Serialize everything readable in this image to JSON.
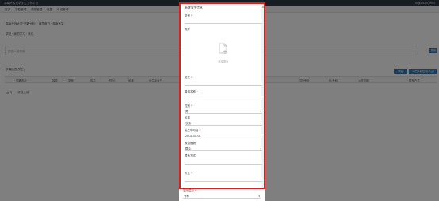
{
  "app": {
    "title": "湖南开放大学学生工作平台",
    "user": "sxguo4@Qmb4"
  },
  "nav": [
    "首页",
    "学籍管理",
    "成绩管理",
    "设置",
    "考试管理"
  ],
  "breadcrumb": "湖南开放大学\"学籍分析\" · 满意度日 · 湖南大学",
  "filters": "学院 · 我的学习 · 状态",
  "search": {
    "placeholder": "搜索人名搜索",
    "button": "搜索"
  },
  "list": {
    "title": "学籍信息(学生)",
    "buttons": {
      "add": "添加",
      "import": "导出学籍信息(学生)"
    },
    "columns": [
      "学籍状态",
      "操作",
      "学号",
      "姓名",
      "性别",
      "民族",
      "出生年月日",
      "联系方式",
      "学历专业",
      "年/专科",
      "入学日期",
      "联系方式"
    ]
  },
  "pager": {
    "prev": "上页",
    "next": "末端上页"
  },
  "modal": {
    "title": "新增学生信息",
    "fields": {
      "student_id": {
        "label": "学号",
        "required": true,
        "value": ""
      },
      "photo": {
        "label": "照片",
        "upload_text": "选择图片"
      },
      "name": {
        "label": "姓名",
        "required": true,
        "value": ""
      },
      "former_name": {
        "label": "曾用名称",
        "required": true,
        "value": ""
      },
      "gender": {
        "label": "性别",
        "required": true,
        "value": "男"
      },
      "ethnicity": {
        "label": "民族",
        "required": false,
        "value": "汉族"
      },
      "birth_date": {
        "label": "出生年月日",
        "required": true,
        "value": "2014-03-23"
      },
      "political_status": {
        "label": "政治面貌",
        "required": false,
        "value": "群众"
      },
      "contact": {
        "label": "联系方式",
        "required": false,
        "value": ""
      },
      "major": {
        "label": "专业",
        "required": true,
        "value": ""
      },
      "level": {
        "label": "学历层次",
        "required": true,
        "value": "专科"
      }
    }
  },
  "colors": {
    "highlight": "#d9201f",
    "primary": "#337ab7",
    "topbar": "#2f3a45"
  },
  "icons": {
    "photo": "image-add-icon",
    "caret": "chevron-down-icon"
  }
}
